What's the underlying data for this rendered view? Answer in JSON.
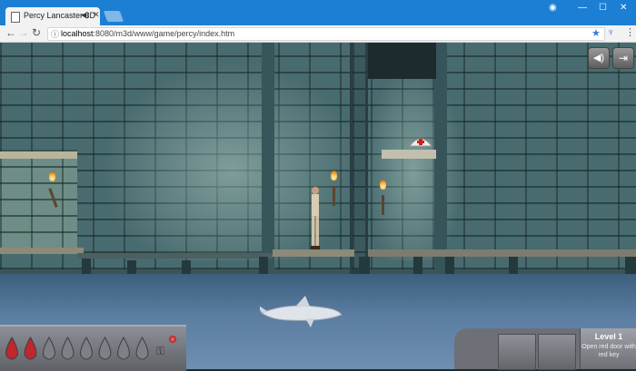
{
  "browser": {
    "tab_title": "Percy Lancaster 3D",
    "tab_sound_icon": "speaker-icon",
    "tab_close": "✕",
    "url_host": "localhost",
    "url_path": ":8080/m3d/www/game/percy/index.htm",
    "window_controls": [
      "person-icon",
      "minimize-icon",
      "maximize-icon",
      "close-icon"
    ]
  },
  "game": {
    "hud": {
      "level_title": "Level 1",
      "objective": "Open red door with red key",
      "health_drops_total": 8,
      "health_drops_filled": 2,
      "colors": {
        "health": "#c0272d",
        "empty_drop": "#7d8086",
        "water": "#5b7ea2"
      }
    }
  }
}
